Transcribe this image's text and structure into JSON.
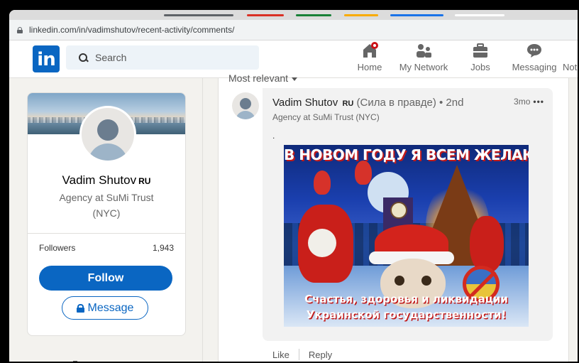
{
  "browser": {
    "url": "linkedin.com/in/vadimshutov/recent-activity/comments/",
    "tab_colors": [
      "#5f6368",
      "#d93025",
      "#188038",
      "#f9ab00",
      "#1a73e8",
      "#ffffff"
    ]
  },
  "nav": {
    "logo": "in",
    "search_placeholder": "Search",
    "items": [
      {
        "label": "Home",
        "icon": "home-icon"
      },
      {
        "label": "My Network",
        "icon": "network-icon"
      },
      {
        "label": "Jobs",
        "icon": "briefcase-icon"
      },
      {
        "label": "Messaging",
        "icon": "messaging-icon"
      },
      {
        "label": "Noti",
        "icon": "notifications-icon"
      }
    ],
    "accent": "#0a66c2"
  },
  "profile": {
    "name": "Vadim Shutov",
    "name_tag": "RU",
    "headline": "Agency at SuMi Trust (NYC)",
    "followers_label": "Followers",
    "followers_count": "1,943",
    "follow_label": "Follow",
    "message_label": "Message"
  },
  "feed": {
    "sort_label": "Most relevant",
    "comment": {
      "author": "Vadim Shutov",
      "author_tag": "RU",
      "author_suffix": "(Сила в правде) • 2nd",
      "subtitle": "Agency at SuMi Trust (NYC)",
      "time": "3mo",
      "more": "•••",
      "body": ".",
      "image_top_text": "В НОВОМ ГОДУ Я ВСЕМ ЖЕЛАЮ",
      "image_bottom_line1": "Счастья, здоровья и ликвидации",
      "image_bottom_line2": "Украинской государственности!"
    },
    "actions": {
      "like": "Like",
      "reply": "Reply"
    }
  }
}
